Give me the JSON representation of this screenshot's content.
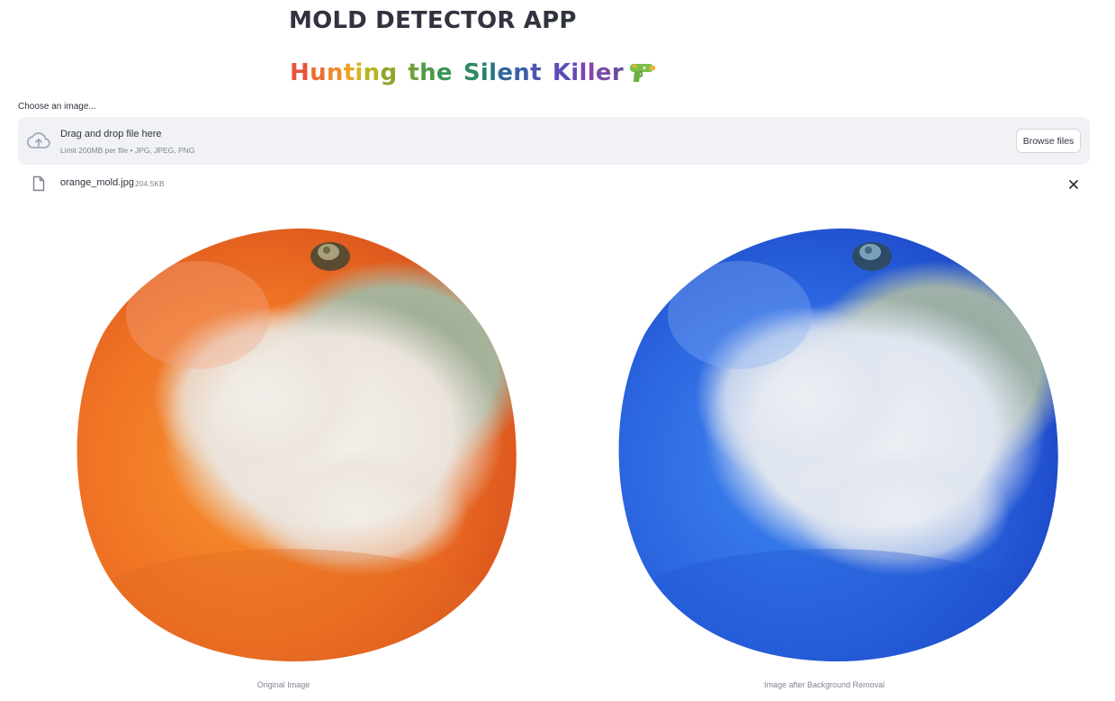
{
  "app": {
    "title": "MOLD DETECTOR APP",
    "subtitle_words": [
      {
        "text": "Hunting",
        "letters": [
          "H",
          "u",
          "n",
          "t",
          "i",
          "n",
          "g"
        ],
        "colors": [
          "#e8533a",
          "#ee6d2f",
          "#f08a2a",
          "#f0a226",
          "#d9b120",
          "#b8b324",
          "#8fa62c"
        ]
      },
      {
        "text": "the",
        "letters": [
          "t",
          "h",
          "e"
        ],
        "colors": [
          "#6fa23a",
          "#4e9a46",
          "#3a9452"
        ]
      },
      {
        "text": "Silent",
        "letters": [
          "S",
          "i",
          "l",
          "e",
          "n",
          "t"
        ],
        "colors": [
          "#2f8a62",
          "#2a7f73",
          "#2a7386",
          "#2f6699",
          "#3b5fab",
          "#4b56b4"
        ]
      },
      {
        "text": "Killer",
        "letters": [
          "K",
          "i",
          "l",
          "l",
          "e",
          "r"
        ],
        "colors": [
          "#5a4db7",
          "#6a49b6",
          "#7846b2",
          "#8745ad",
          "#7a4aa6",
          "#6a4d9b"
        ]
      }
    ],
    "subtitle_emoji": "water-pistol-icon"
  },
  "uploader": {
    "label": "Choose an image...",
    "drop_text": "Drag and drop file here",
    "limit_text": "Limit 200MB per file • JPG, JPEG, PNG",
    "browse_label": "Browse files"
  },
  "file": {
    "name": "orange_mold.jpg",
    "size": "204.5KB"
  },
  "images": {
    "original_caption": "Original Image",
    "processed_caption": "Image after Background Removal"
  },
  "colors": {
    "orange_peel": "#f07a28",
    "blue_peel": "#2b66e0",
    "mold_white": "#eeebe6",
    "mold_green": "#9cab90",
    "dropzone_bg": "#f0f2f6"
  }
}
